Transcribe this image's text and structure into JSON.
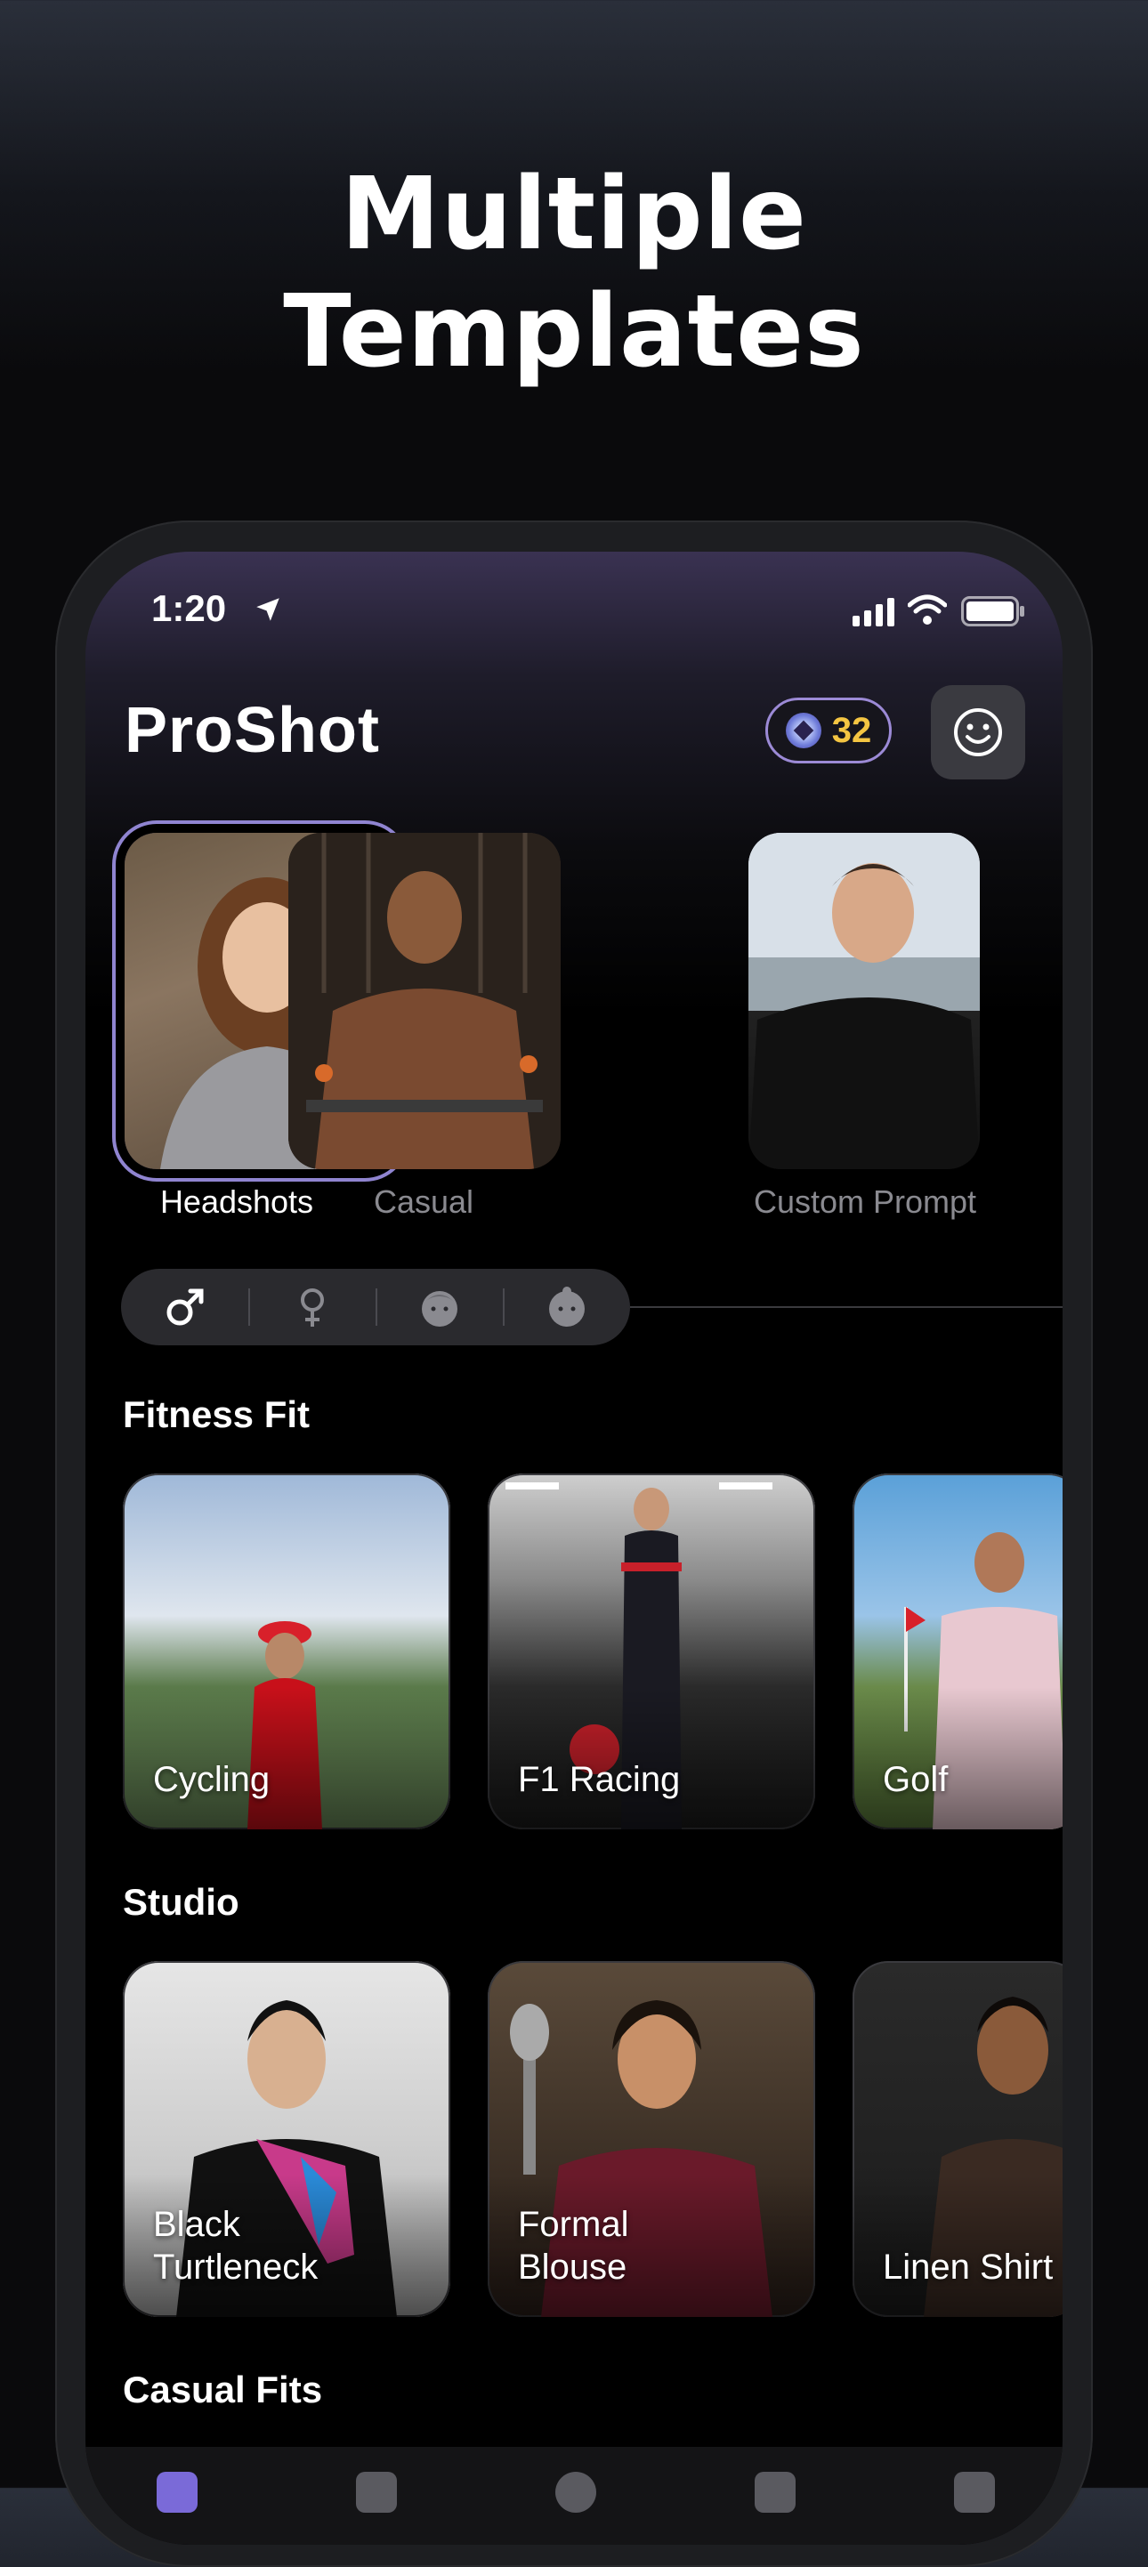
{
  "hero": {
    "line1": "Multiple",
    "line2": "Templates"
  },
  "status_bar": {
    "time": "1:20"
  },
  "header": {
    "title": "ProShot",
    "credits": "32"
  },
  "templates": [
    {
      "label": "Headshots",
      "selected": true
    },
    {
      "label": "Casual",
      "selected": false
    },
    {
      "label": "Custom Prompt",
      "selected": false
    }
  ],
  "gender_filters": [
    "male-icon",
    "female-icon",
    "boy-icon",
    "girl-icon"
  ],
  "sections": [
    {
      "title": "Fitness Fit",
      "cards": [
        "Cycling",
        "F1 Racing",
        "Golf"
      ]
    },
    {
      "title": "Studio",
      "cards": [
        "Black\nTurtleneck",
        "Formal\nBlouse",
        "Linen Shirt"
      ]
    },
    {
      "title": "Casual Fits"
    }
  ],
  "colors": {
    "accent": "#f4c542",
    "selection": "#a89de0"
  }
}
